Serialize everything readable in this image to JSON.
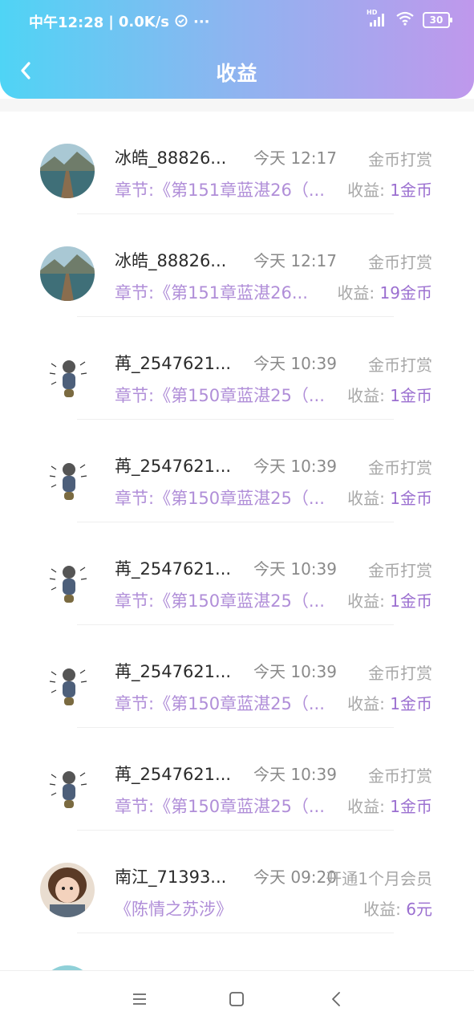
{
  "status_bar": {
    "time": "中午12:28",
    "speed": "0.0K/s",
    "more": "···",
    "hd": "HD",
    "battery": "30"
  },
  "header": {
    "title": "收益"
  },
  "items": [
    {
      "name": "冰皓_88826...",
      "time": "今天 12:17",
      "type": "金币打赏",
      "detail": "章节:《第151章蓝湛26（...",
      "earn_label": "收益:",
      "earn_value": "1金币",
      "avatar": "landscape-avatar"
    },
    {
      "name": "冰皓_88826...",
      "time": "今天 12:17",
      "type": "金币打赏",
      "detail": "章节:《第151章蓝湛26...",
      "earn_label": "收益:",
      "earn_value": "19金币",
      "avatar": "landscape-avatar"
    },
    {
      "name": "苒_2547621...",
      "time": "今天 10:39",
      "type": "金币打赏",
      "detail": "章节:《第150章蓝湛25（...",
      "earn_label": "收益:",
      "earn_value": "1金币",
      "avatar": "cartoon-avatar"
    },
    {
      "name": "苒_2547621...",
      "time": "今天 10:39",
      "type": "金币打赏",
      "detail": "章节:《第150章蓝湛25（...",
      "earn_label": "收益:",
      "earn_value": "1金币",
      "avatar": "cartoon-avatar"
    },
    {
      "name": "苒_2547621...",
      "time": "今天 10:39",
      "type": "金币打赏",
      "detail": "章节:《第150章蓝湛25（...",
      "earn_label": "收益:",
      "earn_value": "1金币",
      "avatar": "cartoon-avatar"
    },
    {
      "name": "苒_2547621...",
      "time": "今天 10:39",
      "type": "金币打赏",
      "detail": "章节:《第150章蓝湛25（...",
      "earn_label": "收益:",
      "earn_value": "1金币",
      "avatar": "cartoon-avatar"
    },
    {
      "name": "苒_2547621...",
      "time": "今天 10:39",
      "type": "金币打赏",
      "detail": "章节:《第150章蓝湛25（...",
      "earn_label": "收益:",
      "earn_value": "1金币",
      "avatar": "cartoon-avatar"
    },
    {
      "name": "南江_71393...",
      "time": "今天 09:20",
      "type": "开通1个月会员",
      "detail": "《陈情之苏涉》",
      "earn_label": "收益:",
      "earn_value": "6元",
      "avatar": "child-photo-avatar"
    },
    {
      "name": "",
      "time": "",
      "type": "",
      "detail": "",
      "earn_label": "",
      "earn_value": "",
      "avatar": "landscape-avatar"
    }
  ],
  "colors": {
    "header_start": "#4fd4f5",
    "header_end": "#bf98ec",
    "accent_purple": "#9b6fd0",
    "chapter_purple": "#b08ed8"
  }
}
